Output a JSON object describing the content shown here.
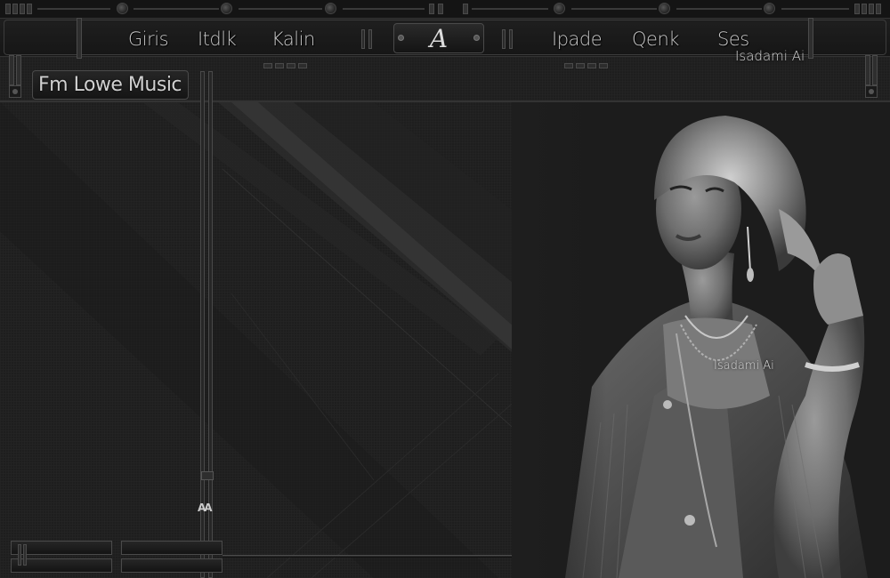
{
  "menu": {
    "left_items": [
      {
        "label": "Giris"
      },
      {
        "label": "Itdlk"
      },
      {
        "label": "Kalin"
      }
    ],
    "right_items": [
      {
        "label": "Ipade"
      },
      {
        "label": "Qenk"
      },
      {
        "label": "Ses"
      }
    ],
    "logo_letter": "A"
  },
  "station": {
    "name": "Fm Lowe Music"
  },
  "signature": {
    "header": "Isadami Ai",
    "photo": "Isadami Ai"
  },
  "brand_mark": "AA",
  "colors": {
    "background": "#1e1e1e",
    "panel": "#161616",
    "border": "#4a4a4a",
    "text": "#c8c8c8"
  }
}
